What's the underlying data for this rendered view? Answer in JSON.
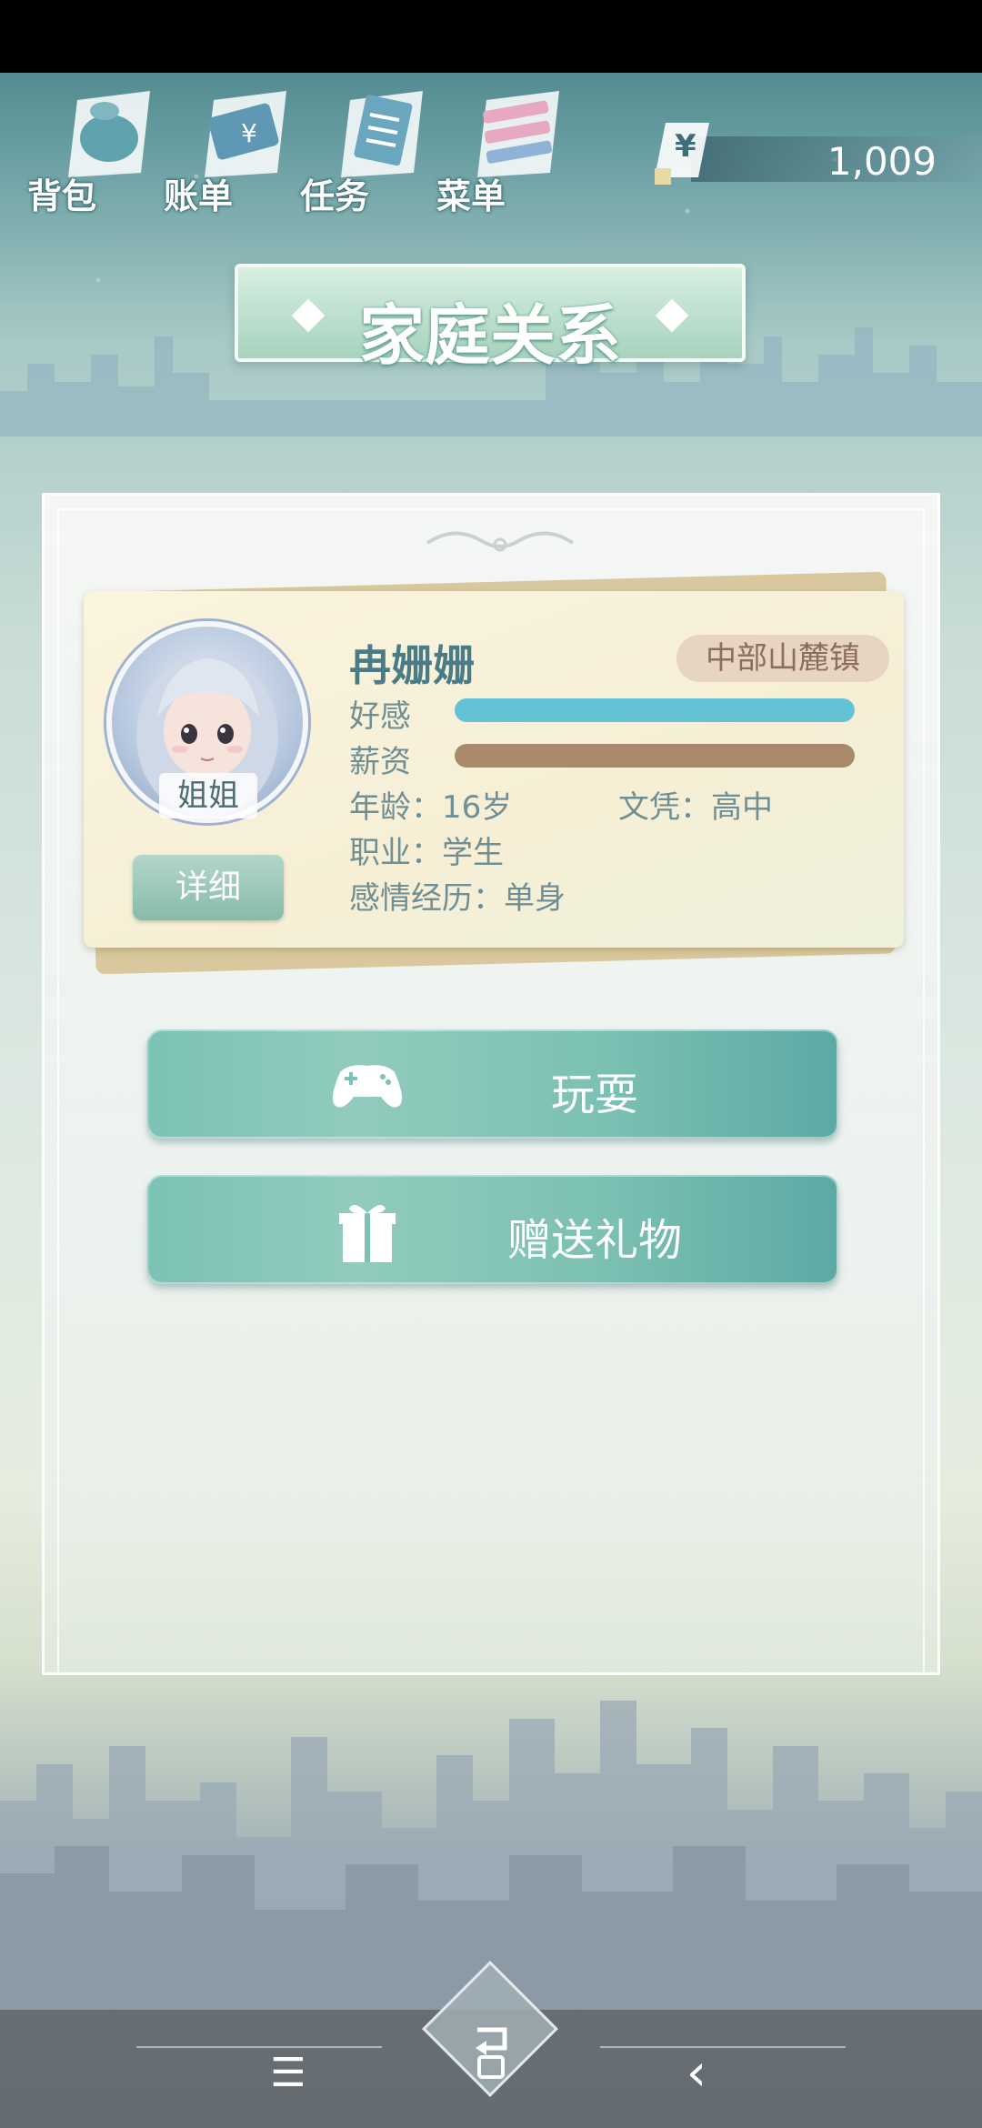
{
  "top_nav": {
    "items": [
      {
        "label": "背包",
        "icon": "bag-icon"
      },
      {
        "label": "账单",
        "icon": "bill-icon"
      },
      {
        "label": "任务",
        "icon": "task-icon"
      },
      {
        "label": "菜单",
        "icon": "menu-icon"
      }
    ],
    "currency_symbol": "¥",
    "money": "1,009"
  },
  "title": "家庭关系",
  "character": {
    "name": "冉姗姗",
    "role": "姐姐",
    "location": "中部山麓镇",
    "detail_button": "详细",
    "stats": [
      {
        "label": "好感",
        "value": 1.0,
        "color": "#63c2d6"
      },
      {
        "label": "薪资",
        "value": 1.0,
        "color": "#a88a6b"
      }
    ],
    "age_label": "年龄：",
    "age": "16岁",
    "education_label": "文凭：",
    "education": "高中",
    "job_label": "职业：",
    "job": "学生",
    "romance_label": "感情经历：",
    "romance": "单身"
  },
  "actions": [
    {
      "label": "玩耍",
      "icon": "gamepad-icon"
    },
    {
      "label": "赠送礼物",
      "icon": "gift-icon"
    }
  ],
  "system_nav": {
    "menu_icon": "☰",
    "home_icon": "home-icon",
    "back_icon": "‹"
  },
  "colors": {
    "accent": "#7cc2b5",
    "name": "#4b7c86",
    "affection_bar": "#63c2d6",
    "salary_bar": "#a88a6b"
  }
}
